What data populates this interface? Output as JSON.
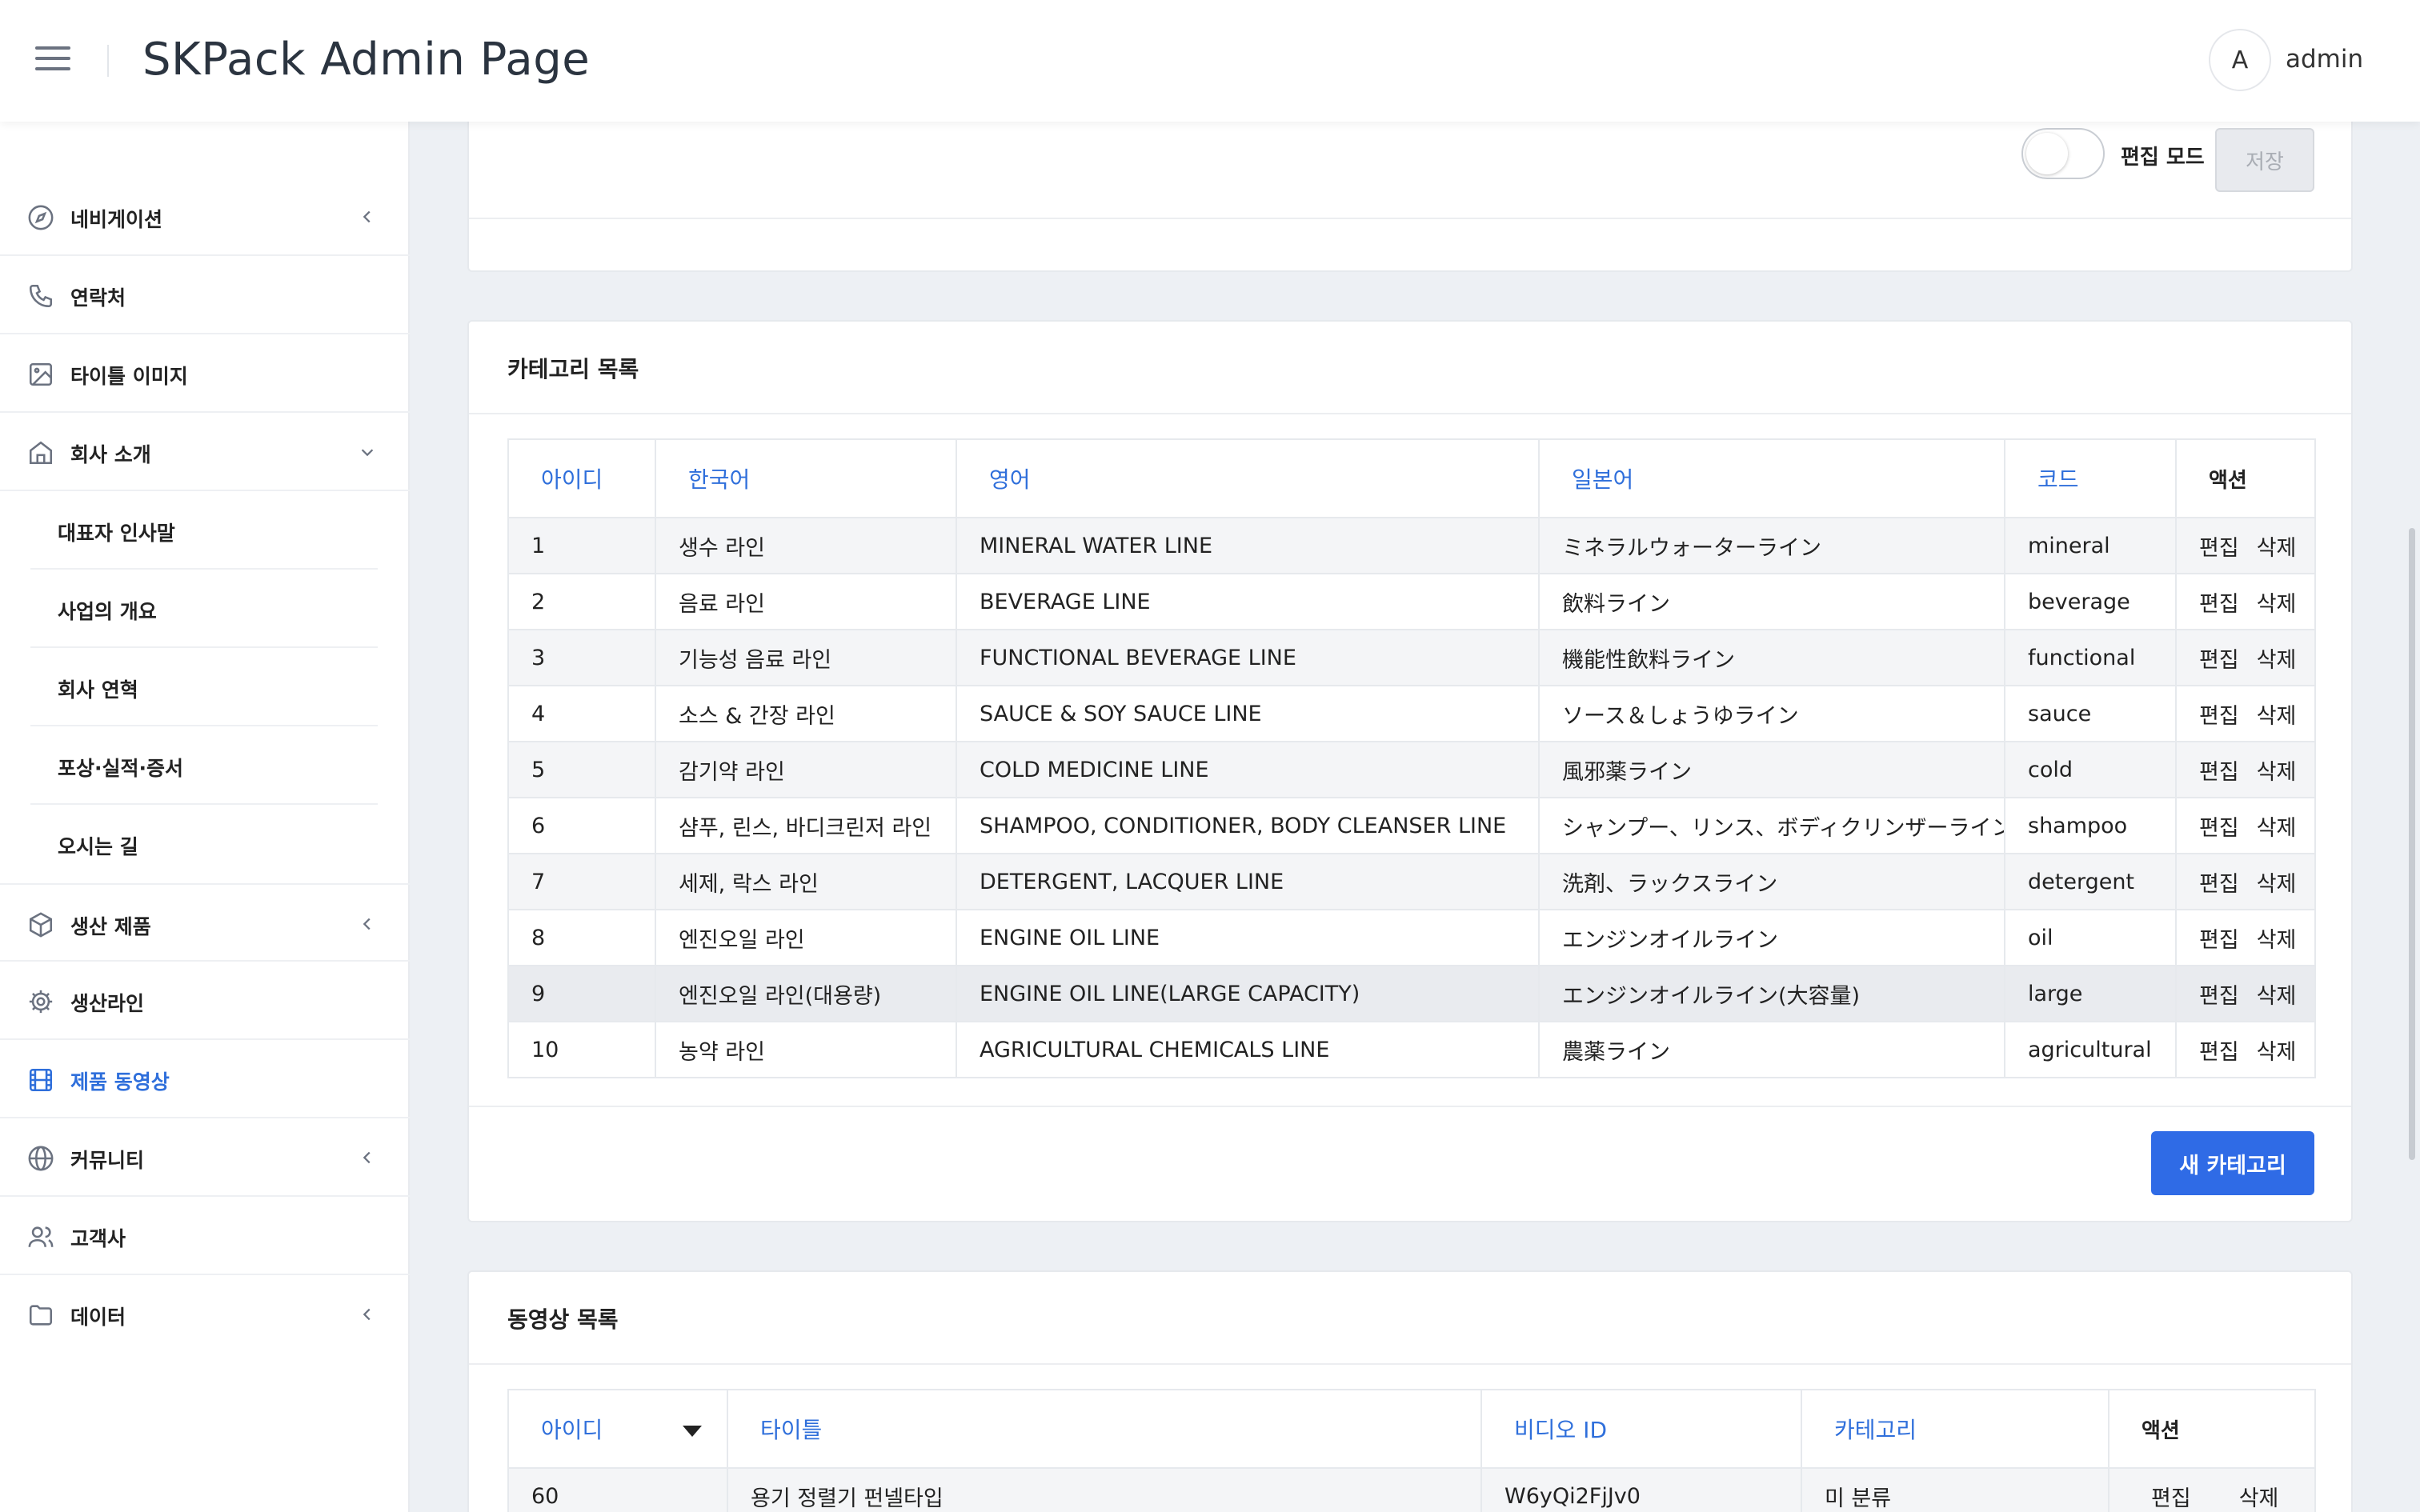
{
  "header": {
    "title": "SKPack Admin Page",
    "avatar_initial": "A",
    "username": "admin"
  },
  "sidebar": {
    "items": [
      {
        "label": "네비게이션",
        "icon": "compass-icon"
      },
      {
        "label": "연락처",
        "icon": "phone-icon"
      },
      {
        "label": "타이틀 이미지",
        "icon": "image-icon"
      },
      {
        "label": "회사 소개",
        "icon": "home-icon"
      },
      {
        "label": "생산 제품",
        "icon": "box-icon"
      },
      {
        "label": "생산라인",
        "icon": "gear-icon"
      },
      {
        "label": "제품 동영상",
        "icon": "film-icon"
      },
      {
        "label": "커뮤니티",
        "icon": "globe-icon"
      },
      {
        "label": "고객사",
        "icon": "users-icon"
      },
      {
        "label": "데이터",
        "icon": "folder-icon"
      }
    ],
    "sub_items": [
      "대표자 인사말",
      "사업의 개요",
      "회사 연혁",
      "포상·실적·증서",
      "오시는 길"
    ]
  },
  "top_card": {
    "toggle_label": "편집 모드",
    "save_label": "저장"
  },
  "category_card": {
    "title": "카테고리 목록",
    "columns": [
      "아이디",
      "한국어",
      "영어",
      "일본어",
      "코드",
      "액션"
    ],
    "rows": [
      [
        "1",
        "생수 라인",
        "MINERAL WATER LINE",
        "ミネラルウォーターライン",
        "mineral"
      ],
      [
        "2",
        "음료 라인",
        "BEVERAGE LINE",
        "飲料ライン",
        "beverage"
      ],
      [
        "3",
        "기능성 음료 라인",
        "FUNCTIONAL BEVERAGE LINE",
        "機能性飲料ライン",
        "functional"
      ],
      [
        "4",
        "소스 & 간장 라인",
        "SAUCE & SOY SAUCE LINE",
        "ソース＆しょうゆライン",
        "sauce"
      ],
      [
        "5",
        "감기약 라인",
        "COLD MEDICINE LINE",
        "風邪薬ライン",
        "cold"
      ],
      [
        "6",
        "샴푸, 린스, 바디크린저 라인",
        "SHAMPOO, CONDITIONER, BODY CLEANSER LINE",
        "シャンプー、リンス、ボディクリンザーライン",
        "shampoo"
      ],
      [
        "7",
        "세제, 락스 라인",
        "DETERGENT, LACQUER LINE",
        "洗剤、ラックスライン",
        "detergent"
      ],
      [
        "8",
        "엔진오일 라인",
        "ENGINE OIL LINE",
        "エンジンオイルライン",
        "oil"
      ],
      [
        "9",
        "엔진오일 라인(대용량)",
        "ENGINE OIL LINE(LARGE CAPACITY)",
        "エンジンオイルライン(大容量)",
        "large"
      ],
      [
        "10",
        "농약 라인",
        "AGRICULTURAL CHEMICALS LINE",
        "農薬ライン",
        "agricultural"
      ]
    ],
    "edit_label": "편집",
    "delete_label": "삭제",
    "new_button": "새 카테고리"
  },
  "video_card": {
    "title": "동영상 목록",
    "columns": [
      "아이디",
      "타이틀",
      "비디오 ID",
      "카테고리",
      "액션"
    ],
    "rows": [
      [
        "60",
        "용기 정렬기 펀넬타입",
        "W6yQi2FjJv0",
        "미 분류"
      ]
    ],
    "edit_label": "편집",
    "delete_label": "삭제"
  },
  "colors": {
    "accent": "#2f6be6",
    "link": "#2f6fdb",
    "background": "#edf0f4"
  }
}
